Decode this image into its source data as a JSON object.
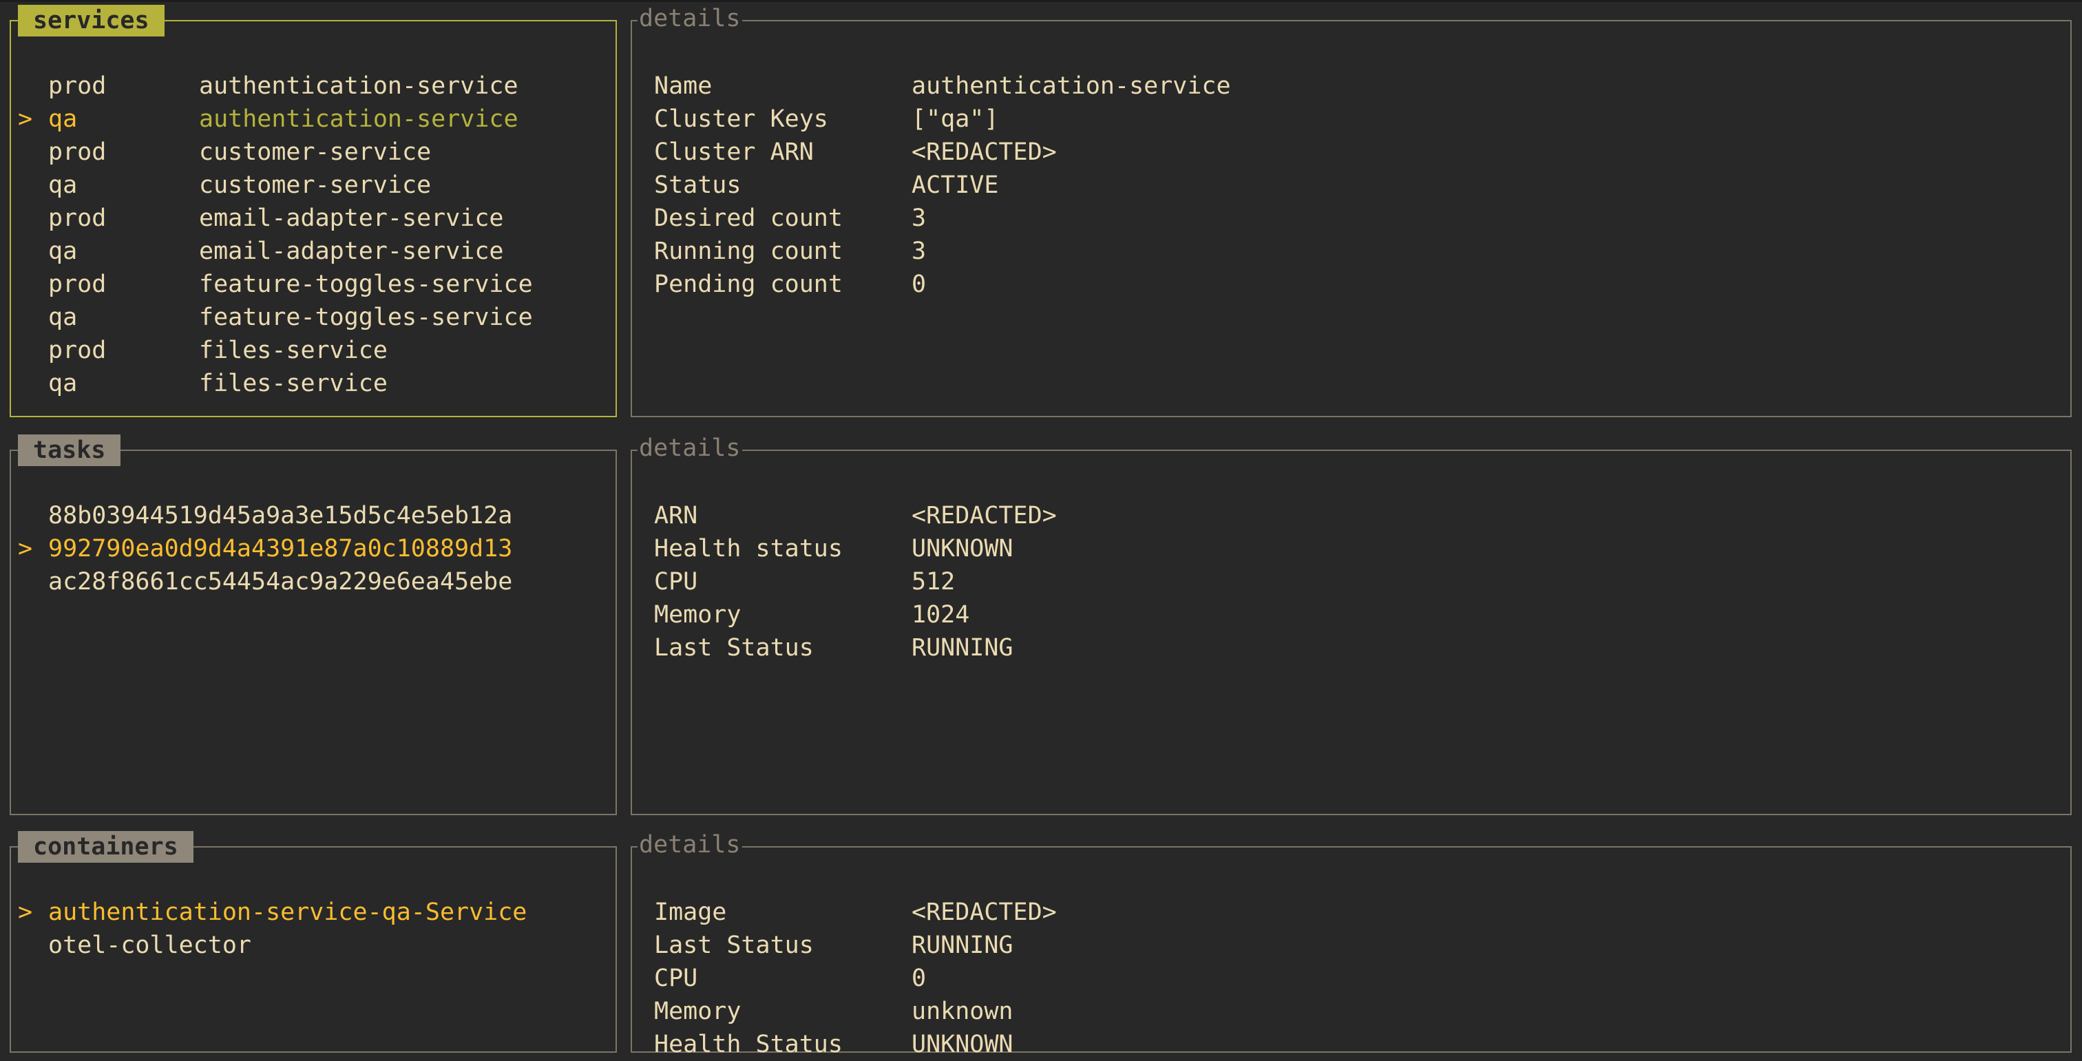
{
  "services": {
    "title": "services",
    "items": [
      {
        "env": "prod",
        "name": "authentication-service",
        "selected": false
      },
      {
        "env": "qa",
        "name": "authentication-service",
        "selected": true
      },
      {
        "env": "prod",
        "name": "customer-service",
        "selected": false
      },
      {
        "env": "qa",
        "name": "customer-service",
        "selected": false
      },
      {
        "env": "prod",
        "name": "email-adapter-service",
        "selected": false
      },
      {
        "env": "qa",
        "name": "email-adapter-service",
        "selected": false
      },
      {
        "env": "prod",
        "name": "feature-toggles-service",
        "selected": false
      },
      {
        "env": "qa",
        "name": "feature-toggles-service",
        "selected": false
      },
      {
        "env": "prod",
        "name": "files-service",
        "selected": false
      },
      {
        "env": "qa",
        "name": "files-service",
        "selected": false
      }
    ]
  },
  "service_details": {
    "title": "details",
    "rows": [
      {
        "key": "Name",
        "value": "authentication-service"
      },
      {
        "key": "Cluster Keys",
        "value": "[\"qa\"]"
      },
      {
        "key": "Cluster ARN",
        "value": "<REDACTED>"
      },
      {
        "key": "Status",
        "value": "ACTIVE"
      },
      {
        "key": "Desired count",
        "value": "3"
      },
      {
        "key": "Running count",
        "value": "3"
      },
      {
        "key": "Pending count",
        "value": "0"
      }
    ]
  },
  "tasks": {
    "title": "tasks",
    "items": [
      {
        "id": "88b03944519d45a9a3e15d5c4e5eb12a",
        "selected": false
      },
      {
        "id": "992790ea0d9d4a4391e87a0c10889d13",
        "selected": true
      },
      {
        "id": "ac28f8661cc54454ac9a229e6ea45ebe",
        "selected": false
      }
    ]
  },
  "task_details": {
    "title": "details",
    "rows": [
      {
        "key": "ARN",
        "value": "<REDACTED>"
      },
      {
        "key": "Health status",
        "value": "UNKNOWN"
      },
      {
        "key": "CPU",
        "value": "512"
      },
      {
        "key": "Memory",
        "value": "1024"
      },
      {
        "key": "Last Status",
        "value": "RUNNING"
      }
    ]
  },
  "containers": {
    "title": "containers",
    "items": [
      {
        "name": "authentication-service-qa-Service",
        "selected": true
      },
      {
        "name": "otel-collector",
        "selected": false
      }
    ]
  },
  "container_details": {
    "title": "details",
    "rows": [
      {
        "key": "Image",
        "value": "<REDACTED>"
      },
      {
        "key": "Last Status",
        "value": "RUNNING"
      },
      {
        "key": "CPU",
        "value": "0"
      },
      {
        "key": "Memory",
        "value": "unknown"
      },
      {
        "key": "Health Status",
        "value": "UNKNOWN"
      }
    ]
  },
  "selection_marker": ">",
  "colors": {
    "background": "#282828",
    "foreground": "#ebdbb2",
    "active_accent": "#b5b33c",
    "selected_item": "#fabd2f",
    "inactive_border": "#7c7467",
    "inactive_badge": "#8f877a"
  }
}
